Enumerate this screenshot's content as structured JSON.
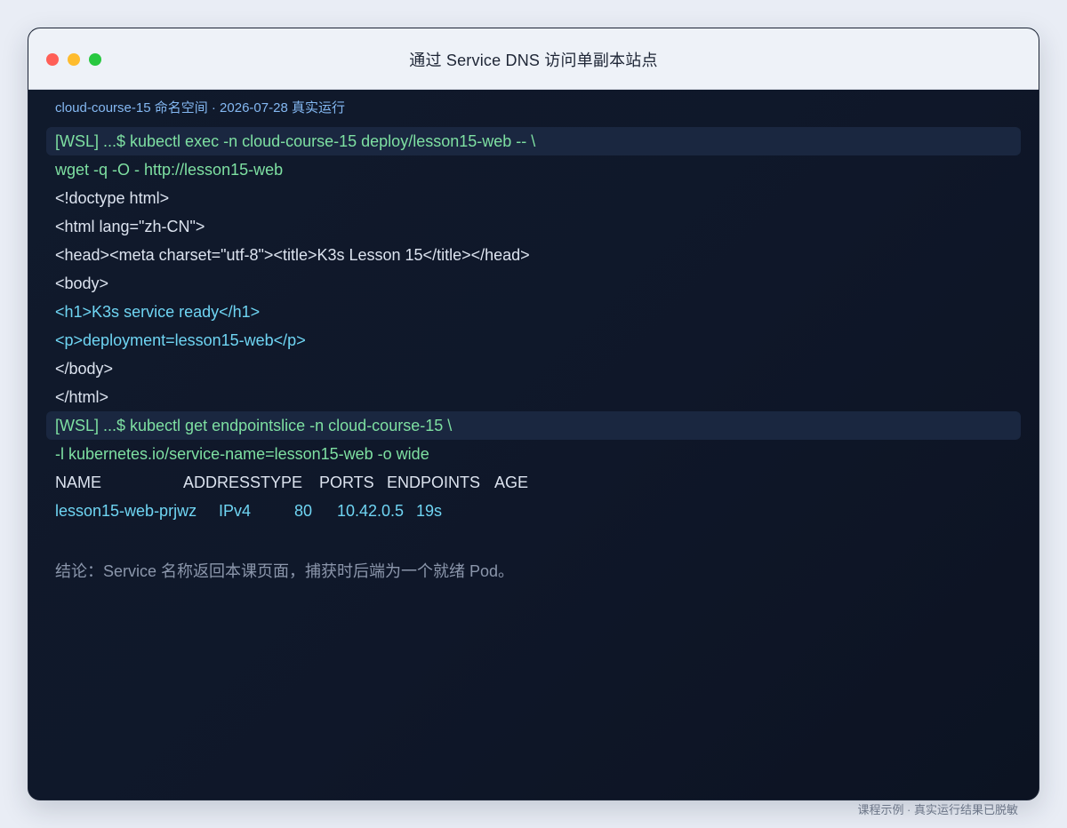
{
  "window": {
    "title": "通过 Service DNS 访问单副本站点"
  },
  "meta": "cloud-course-15 命名空间 · 2026-07-28 真实运行",
  "terminal": {
    "lines": [
      "[WSL] ...$ kubectl exec -n cloud-course-15 deploy/lesson15-web -- \\",
      "wget -q -O - http://lesson15-web",
      "<!doctype html>",
      "<html lang=\"zh-CN\">",
      "<head><meta charset=\"utf-8\"><title>K3s Lesson 15</title></head>",
      "<body>",
      "<h1>K3s service ready</h1>",
      "<p>deployment=lesson15-web</p>",
      "</body>",
      "</html>",
      "[WSL] ...$ kubectl get endpointslice -n cloud-course-15 \\",
      "-l kubernetes.io/service-name=lesson15-web -o wide"
    ],
    "table": {
      "headers": [
        "NAME",
        "ADDRESSTYPE",
        "PORTS",
        "ENDPOINTS",
        "AGE"
      ],
      "row": [
        "lesson15-web-prjwz",
        "IPv4",
        "80",
        "10.42.0.5",
        "19s"
      ]
    }
  },
  "conclusion": "结论：Service 名称返回本课页面，捕获时后端为一个就绪 Pod。",
  "footer": "课程示例 · 真实运行结果已脱敏",
  "colors": {
    "prompt": "#7ee0a2",
    "highlight": "#6fd5f3",
    "output": "#dce3ef",
    "background": "#0e1526"
  }
}
